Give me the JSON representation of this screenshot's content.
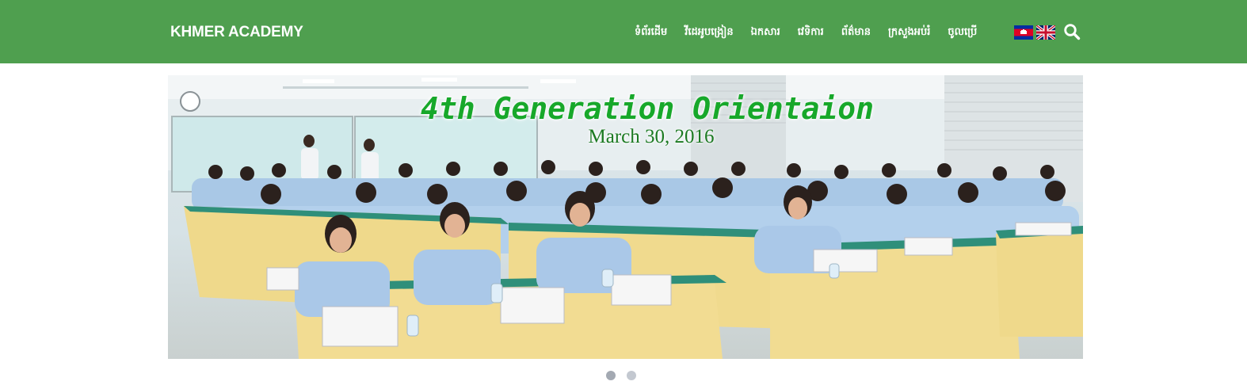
{
  "navbar": {
    "brand": "KHMER ACADEMY",
    "menu": [
      {
        "label": "ទំព័រដើម"
      },
      {
        "label": "វីដេអូបង្រៀន"
      },
      {
        "label": "ឯកសារ"
      },
      {
        "label": "វេទិការ"
      },
      {
        "label": "ព័ត៌មាន"
      },
      {
        "label": "ក្រសួងអប់រំ"
      },
      {
        "label": "ចូលប្រើ"
      }
    ],
    "languages": [
      {
        "icon": "cambodia-flag-icon"
      },
      {
        "icon": "uk-flag-icon"
      }
    ],
    "search_icon": "search-icon"
  },
  "slider": {
    "slides": [
      {
        "title": "4th Generation Orientaion",
        "date": "March 30, 2016"
      },
      {}
    ],
    "active_index": 0,
    "indicator_count": 2
  },
  "colors": {
    "navbar_bg": "#4f9f4f",
    "brand_text": "#ffffff",
    "caption_title": "#17a82a",
    "caption_date": "#1c7a22",
    "indicator_active": "#a3a9b2",
    "indicator_inactive": "#c3c8d0"
  }
}
